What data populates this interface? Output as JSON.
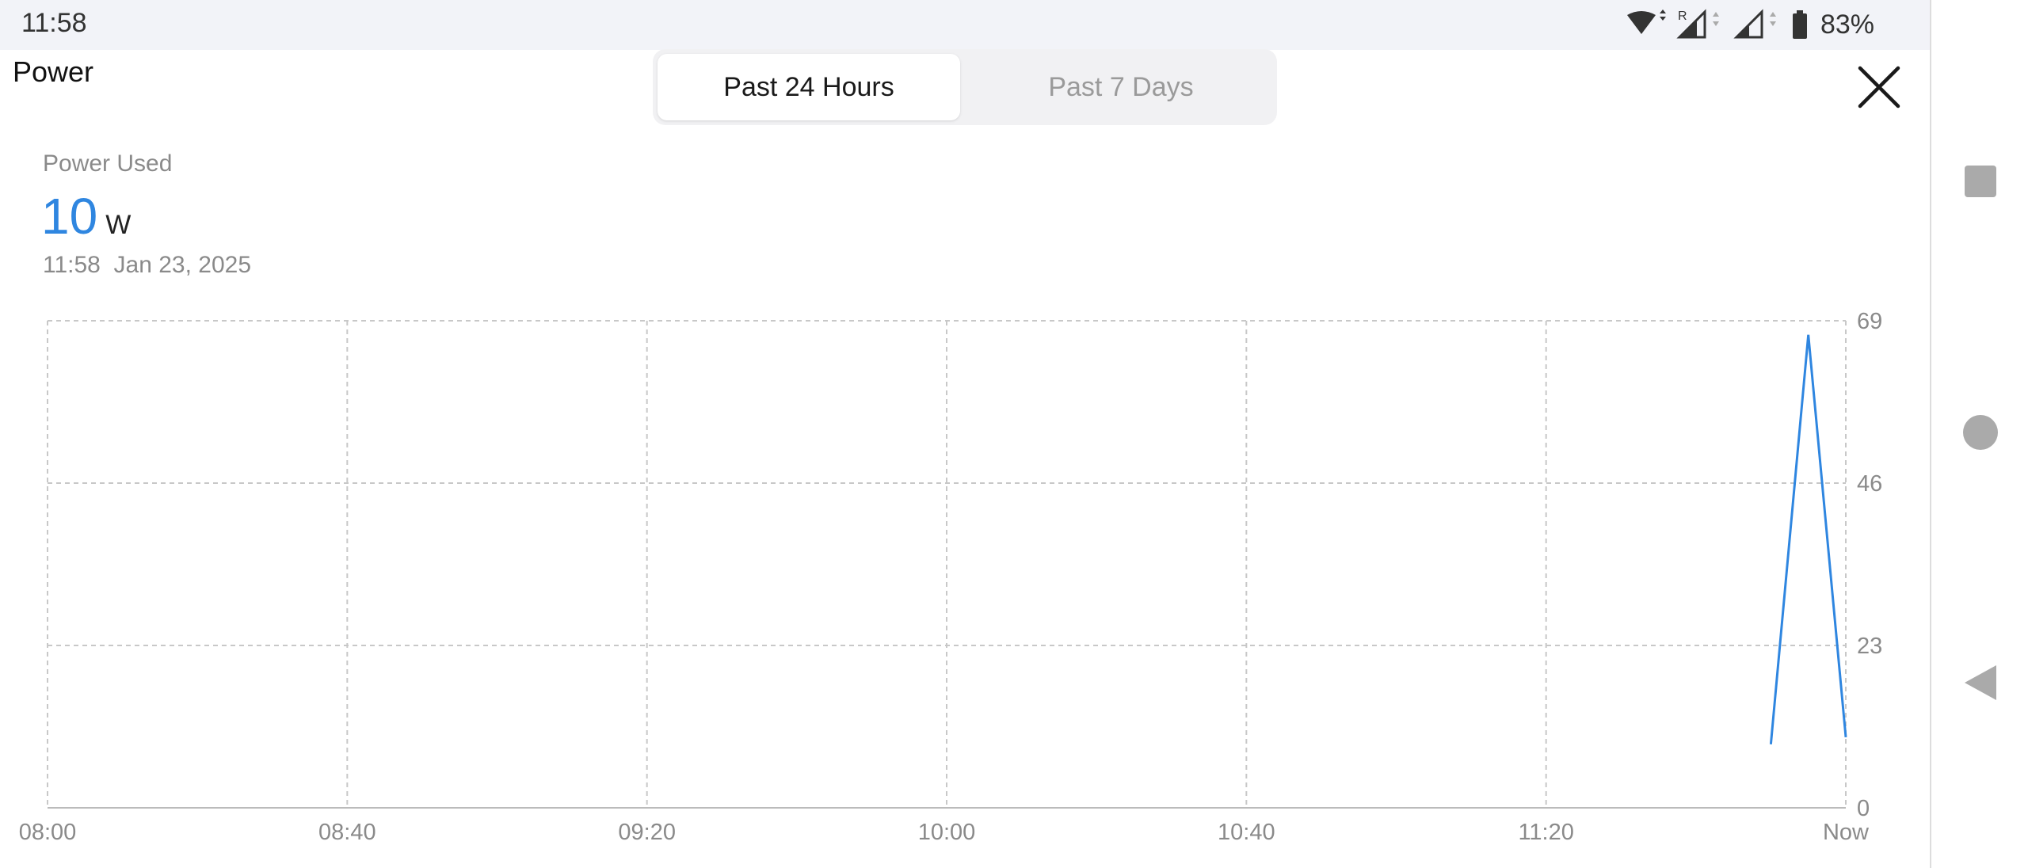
{
  "status_bar": {
    "time": "11:58",
    "battery_percent": "83%",
    "icons": [
      "wifi-icon",
      "signal-roaming-icon",
      "signal-icon",
      "battery-icon"
    ]
  },
  "header": {
    "title": "Power",
    "tabs": [
      {
        "label": "Past 24 Hours",
        "active": true
      },
      {
        "label": "Past 7 Days",
        "active": false
      }
    ],
    "close_icon": "close-icon"
  },
  "summary": {
    "label": "Power Used",
    "value": "10",
    "unit": "W",
    "timestamp": "11:58  Jan 23, 2025"
  },
  "nav_bar": {
    "icons": [
      "recents-icon",
      "home-icon",
      "back-icon"
    ]
  },
  "colors": {
    "accent": "#2f86e0",
    "line": "#2f86e0",
    "grid": "#c8c8c8",
    "muted_text": "#8a8a8a",
    "status_bar_bg": "#f2f3f8"
  },
  "chart_data": {
    "type": "line",
    "x_tick_labels": [
      "08:00",
      "08:40",
      "09:20",
      "10:00",
      "10:40",
      "11:20",
      "Now"
    ],
    "y_tick_labels": [
      "69",
      "46",
      "23",
      "0"
    ],
    "ylim": [
      0,
      69
    ],
    "y_ticks": [
      0,
      23,
      46,
      69
    ],
    "x_range": [
      "08:00",
      "12:00"
    ],
    "grid": true,
    "grid_style": "dashed",
    "series": [
      {
        "points": [
          {
            "x": "11:50",
            "y": 9
          },
          {
            "x": "11:55",
            "y": 67
          },
          {
            "x": "12:00",
            "y": 10
          }
        ]
      }
    ]
  }
}
